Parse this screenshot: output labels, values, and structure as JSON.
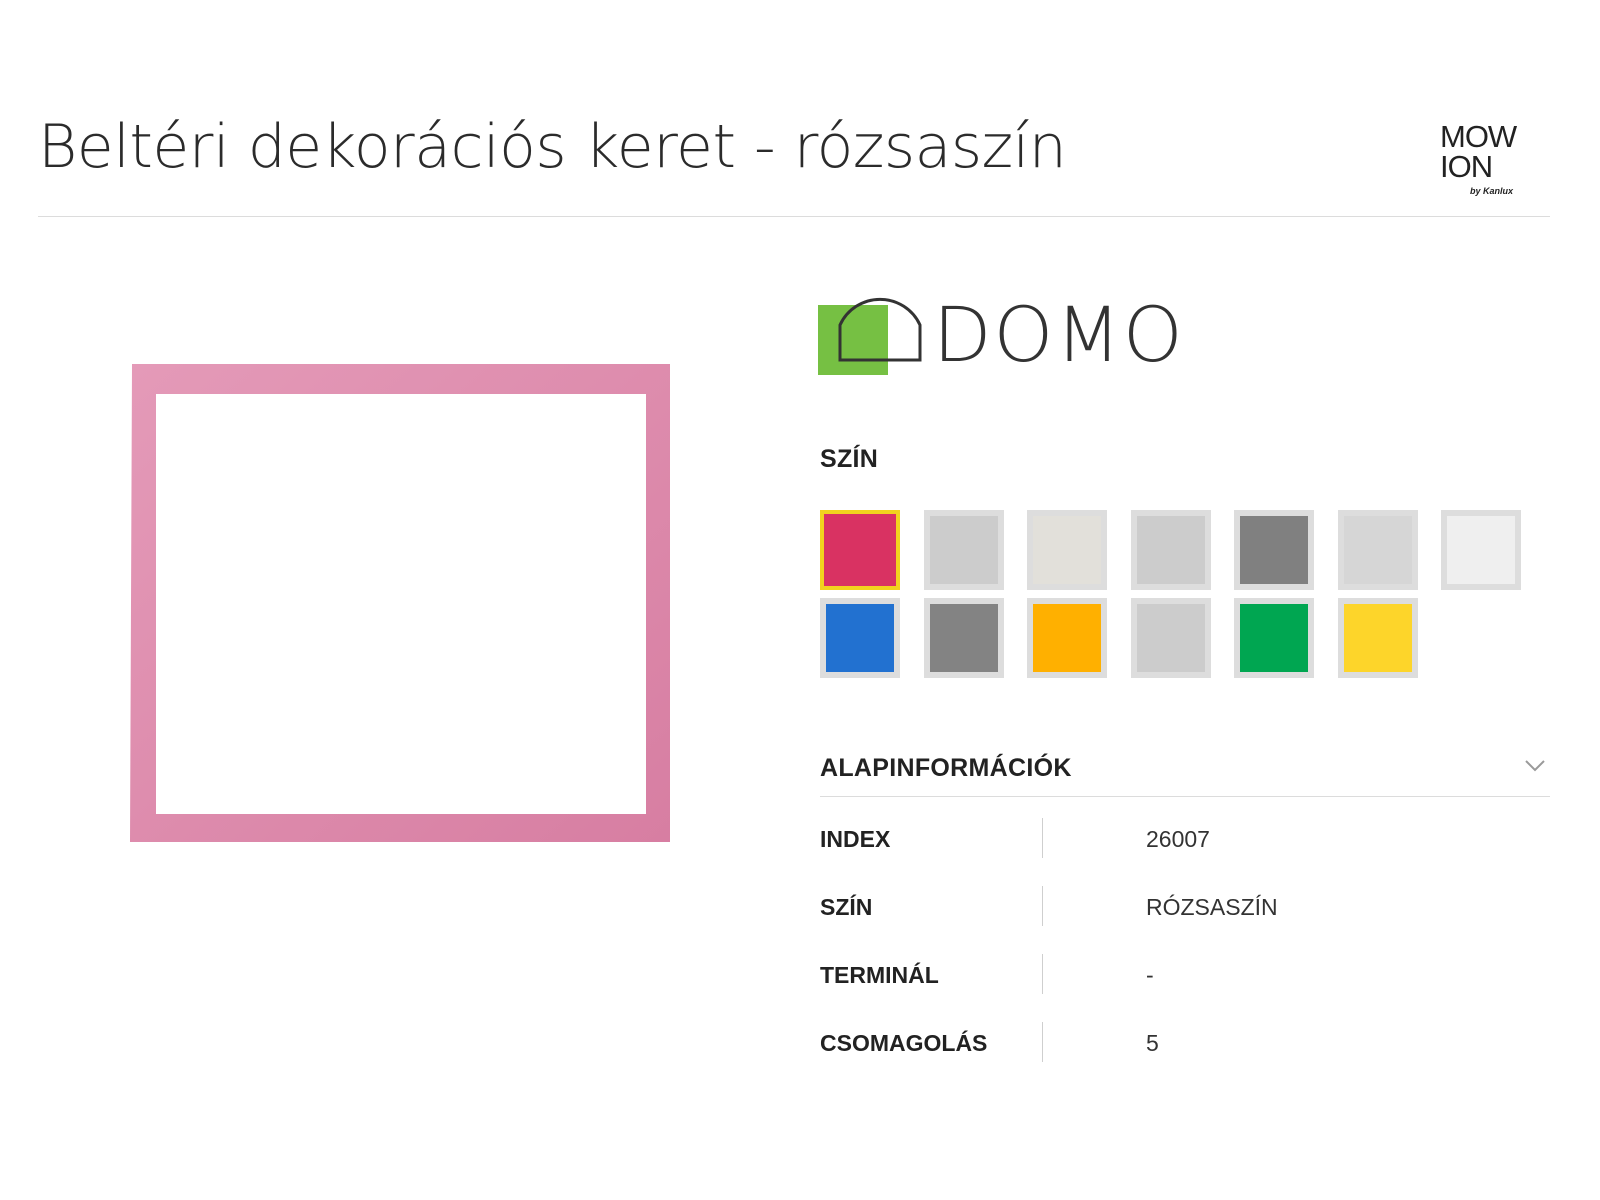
{
  "header": {
    "title": "Beltéri dekorációs keret - rózsaszín",
    "brand_logo": {
      "line1": "MOW",
      "line2": "ION",
      "byline": "by Kanlux"
    }
  },
  "product": {
    "image_icon": "pink-square-frame",
    "frame_color": "#e08fb0",
    "series_logo": {
      "text": "DOMO",
      "accent": "#76c043"
    }
  },
  "color_section": {
    "label": "SZÍN",
    "swatches": [
      {
        "color": "#d93262",
        "selected": true
      },
      {
        "color": "#cccccc",
        "selected": false
      },
      {
        "color": "#e2e0da",
        "selected": false
      },
      {
        "color": "#cccccc",
        "selected": false
      },
      {
        "color": "#808080",
        "selected": false
      },
      {
        "color": "#d6d6d6",
        "selected": false
      },
      {
        "color": "#efefef",
        "selected": false
      },
      {
        "color": "#2271d0",
        "selected": false
      },
      {
        "color": "#838383",
        "selected": false
      },
      {
        "color": "#ffb000",
        "selected": false
      },
      {
        "color": "#cccccc",
        "selected": false
      },
      {
        "color": "#00a651",
        "selected": false
      },
      {
        "color": "#fdd52a",
        "selected": false
      }
    ]
  },
  "basic_info": {
    "label": "ALAPINFORMÁCIÓK",
    "toggle_icon": "chevron-down-icon",
    "rows": [
      {
        "key": "INDEX",
        "value": "26007"
      },
      {
        "key": "SZÍN",
        "value": "RÓZSASZÍN"
      },
      {
        "key": "TERMINÁL",
        "value": "-"
      },
      {
        "key": "CSOMAGOLÁS",
        "value": "5"
      }
    ]
  }
}
